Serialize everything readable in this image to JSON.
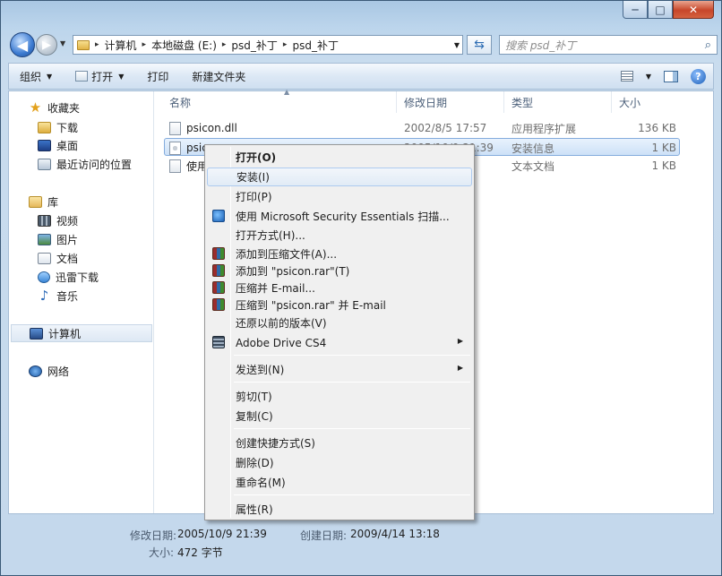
{
  "window": {
    "min_glyph": "─",
    "max_glyph": "□",
    "close_glyph": "✕"
  },
  "address_bar": {
    "crumbs": [
      "计算机",
      "本地磁盘 (E:)",
      "psd_补丁",
      "psd_补丁"
    ],
    "sep": "▸",
    "search_placeholder": "搜索 psd_补丁"
  },
  "toolbar": {
    "organize": "组织",
    "open": "打开",
    "print": "打印",
    "new_folder": "新建文件夹",
    "help": "?"
  },
  "nav": {
    "favorites": "收藏夹",
    "downloads": "下载",
    "desktop": "桌面",
    "recent": "最近访问的位置",
    "libraries": "库",
    "videos": "视频",
    "pictures": "图片",
    "documents": "文档",
    "thunder": "迅雷下载",
    "music": "音乐",
    "computer": "计算机",
    "network": "网络"
  },
  "columns": {
    "name": "名称",
    "date": "修改日期",
    "type": "类型",
    "size": "大小"
  },
  "files": [
    {
      "name": "psicon.dll",
      "date": "2002/8/5 17:57",
      "type": "应用程序扩展",
      "size": "136 KB"
    },
    {
      "name": "psic",
      "date": "2005/10/9 21:39",
      "type": "安装信息",
      "size": "1 KB"
    },
    {
      "name": "使用",
      "date": "",
      "type": "文本文档",
      "size": "1 KB"
    }
  ],
  "context_menu": {
    "open": "打开(O)",
    "install": "安装(I)",
    "print": "打印(P)",
    "mse_scan": "使用 Microsoft Security Essentials 扫描...",
    "open_with": "打开方式(H)...",
    "add_to_archive": "添加到压缩文件(A)...",
    "add_to_rar": "添加到 \"psicon.rar\"(T)",
    "compress_email": "压缩并 E-mail...",
    "compress_rar_email": "压缩到 \"psicon.rar\" 并 E-mail",
    "restore_versions": "还原以前的版本(V)",
    "adobe_drive": "Adobe Drive CS4",
    "send_to": "发送到(N)",
    "cut": "剪切(T)",
    "copy": "复制(C)",
    "create_shortcut": "创建快捷方式(S)",
    "delete": "删除(D)",
    "rename": "重命名(M)",
    "properties": "属性(R)"
  },
  "details": {
    "modified_label": "修改日期:",
    "modified_value": "2005/10/9 21:39",
    "created_label": "创建日期:",
    "created_value": "2009/4/14 13:18",
    "size_label": "大小:",
    "size_value": "472 字节"
  }
}
